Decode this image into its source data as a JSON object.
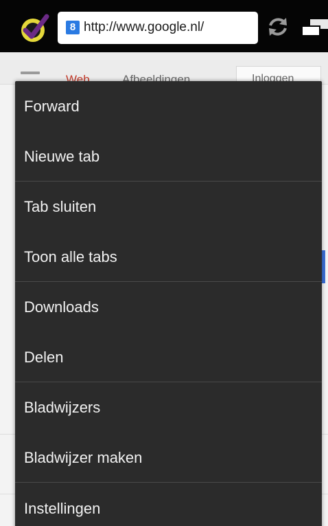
{
  "browser": {
    "url": "http://www.google.nl/",
    "favicon_letter": "8"
  },
  "page_behind": {
    "tab_web": "Web",
    "tab_images": "Afbeeldingen",
    "login_button": "Inloggen"
  },
  "menu": {
    "items": [
      {
        "label": "Forward"
      },
      {
        "label": "Nieuwe tab"
      },
      {
        "label": "Tab sluiten"
      },
      {
        "label": "Toon alle tabs"
      },
      {
        "label": "Downloads"
      },
      {
        "label": "Delen"
      },
      {
        "label": "Bladwijzers"
      },
      {
        "label": "Bladwijzer maken"
      },
      {
        "label": "Instellingen"
      }
    ]
  },
  "colors": {
    "menu_background": "#2b2b2b",
    "menu_text": "#f2f2f2",
    "toolbar_background": "#050505",
    "accent_blue": "#3c6fd6",
    "logo_purple": "#6b2a86",
    "logo_yellow": "#e5d83a"
  },
  "icons": {
    "app_logo": "checkmark-logo-icon",
    "reload": "reload-icon",
    "tabs": "tabs-icon",
    "favicon": "google-favicon-icon"
  }
}
